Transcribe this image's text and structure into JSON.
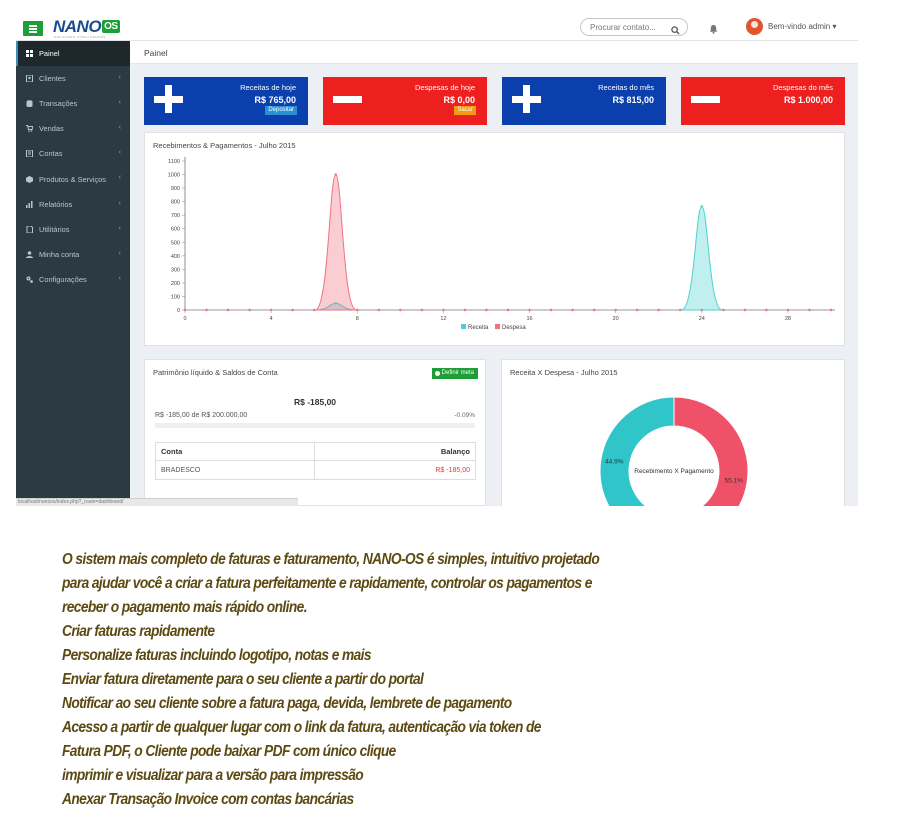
{
  "app": {
    "logo_text": "NANO",
    "logo_badge": "OS",
    "logo_sub": "SOLUÇÕES INTELIGENTES",
    "search_placeholder": "Procurar contato...",
    "user_menu": "Bem-vindo admin ▾",
    "status_url": "localhost/nanoos/index.php?_route=dashboard/"
  },
  "sidebar": {
    "items": [
      {
        "label": "Painel",
        "icon": "grid-icon"
      },
      {
        "label": "Clientes",
        "icon": "address-book-icon"
      },
      {
        "label": "Transações",
        "icon": "database-icon"
      },
      {
        "label": "Vendas",
        "icon": "cart-icon"
      },
      {
        "label": "Contas",
        "icon": "book-icon"
      },
      {
        "label": "Produtos & Serviços",
        "icon": "cube-icon"
      },
      {
        "label": "Relatórios",
        "icon": "bar-chart-icon"
      },
      {
        "label": "Utilitários",
        "icon": "file-icon"
      },
      {
        "label": "Minha conta",
        "icon": "user-icon"
      },
      {
        "label": "Configurações",
        "icon": "cogs-icon"
      }
    ],
    "chevron": "‹"
  },
  "breadcrumb": "Painel",
  "stats": [
    {
      "label": "Receitas de hoje",
      "value": "R$ 765,00",
      "button": "Depositar",
      "color": "#0b3fad"
    },
    {
      "label": "Despesas de hoje",
      "value": "R$ 0,00",
      "button": "Sacar",
      "color": "#ee1f1f"
    },
    {
      "label": "Receitas do mês",
      "value": "R$ 815,00",
      "color": "#0b3fad"
    },
    {
      "label": "Despesas do mês",
      "value": "R$ 1.000,00",
      "color": "#ee1f1f"
    }
  ],
  "chart_data": [
    {
      "type": "area",
      "title": "Recebimentos & Pagamentos - Julho 2015",
      "x": [
        0,
        1,
        2,
        3,
        4,
        5,
        6,
        7,
        8,
        9,
        10,
        11,
        12,
        13,
        14,
        15,
        16,
        17,
        18,
        19,
        20,
        21,
        22,
        23,
        24,
        25,
        26,
        27,
        28,
        29,
        30
      ],
      "xticks": [
        0,
        4,
        8,
        12,
        16,
        20,
        24,
        28
      ],
      "ylim": [
        0,
        1100
      ],
      "yticks": [
        0,
        100,
        200,
        300,
        400,
        500,
        600,
        700,
        800,
        900,
        1000,
        1100
      ],
      "legend_position": "bottom",
      "series": [
        {
          "name": "Receita",
          "color": "#4bd1d3",
          "values": [
            0,
            0,
            0,
            0,
            0,
            0,
            0,
            50,
            0,
            0,
            0,
            0,
            0,
            0,
            0,
            0,
            0,
            0,
            0,
            0,
            0,
            0,
            0,
            0,
            765,
            0,
            0,
            0,
            0,
            0,
            0
          ]
        },
        {
          "name": "Despesa",
          "color": "#f2707f",
          "values": [
            0,
            0,
            0,
            0,
            0,
            0,
            0,
            1000,
            0,
            0,
            0,
            0,
            0,
            0,
            0,
            0,
            0,
            0,
            0,
            0,
            0,
            0,
            0,
            0,
            0,
            0,
            0,
            0,
            0,
            0,
            0
          ]
        }
      ]
    },
    {
      "type": "pie",
      "title": "Receita X Despesa - Julho 2015",
      "center_label": "Recebimento X Pagamento",
      "slices": [
        {
          "label": "Receita",
          "value": 44.9,
          "display": "44.9%",
          "color": "#30c5c8"
        },
        {
          "label": "Despesa",
          "value": 55.1,
          "display": "55.1%",
          "color": "#ef5168"
        }
      ]
    }
  ],
  "patrimonio": {
    "title": "Patrimônio líquido & Saldos de Conta",
    "meta_button": "Definir meta",
    "value": "R$ -185,00",
    "progress_text": "R$ -185,00 de R$ 200.000,00",
    "progress_pct": "-0.09%",
    "progress_fraction": 0,
    "table_headers": {
      "account": "Conta",
      "balance": "Balanço"
    },
    "rows": [
      {
        "account": "BRADESCO",
        "balance": "R$ -185,00"
      }
    ]
  },
  "description": {
    "lines": [
      "O sistem mais completo de faturas e faturamento, NANO-OS é simples, intuitivo  projetado",
      "para ajudar você a criar a fatura perfeitamente e rapidamente, controlar os pagamentos e",
      "receber o pagamento mais rápido online.",
      "Criar faturas rapidamente",
      "Personalize faturas incluindo logotipo, notas e mais",
      "Enviar fatura diretamente para o seu cliente a partir do portal",
      "Notificar ao seu cliente sobre a fatura paga, devida, lembrete de pagamento",
      "Acesso a partir de qualquer lugar com o link da fatura, autenticação via token de",
      "Fatura PDF, o Cliente pode baixar PDF  com único clique",
      "imprimir e visualizar  para a versão para impressão",
      "Anexar Transação Invoice com contas bancárias"
    ],
    "color": "#5c4a12"
  }
}
